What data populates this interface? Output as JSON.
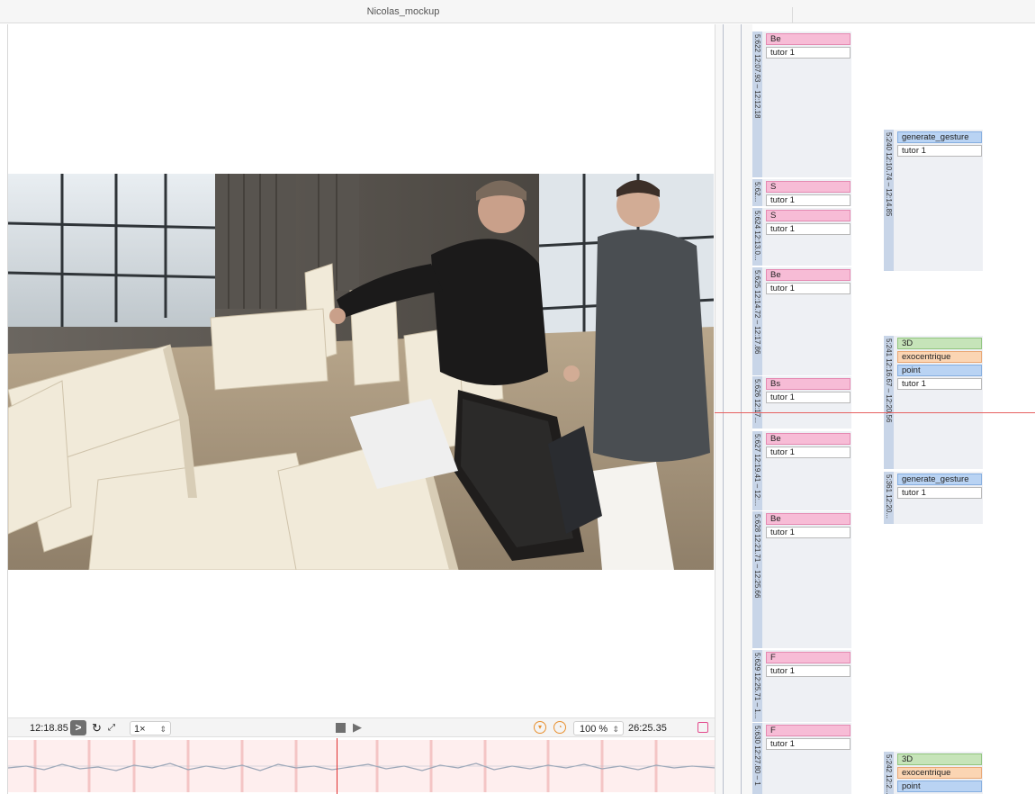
{
  "window": {
    "title": "Nicolas_mockup"
  },
  "player": {
    "current_time": "12:18.85",
    "rate": "1×",
    "zoom": "100 %",
    "duration": "26:25.35",
    "icons": [
      "next-icon",
      "loop-icon",
      "fullscreen-icon",
      "stop-icon",
      "play-icon",
      "marker-icon",
      "clock-icon",
      "sidebar-toggle-icon"
    ]
  },
  "annotations": {
    "col1": [
      {
        "time": "5:622 12:07.93 – 12:12.18",
        "tags": [
          {
            "text": "Be",
            "color": "pink"
          },
          {
            "text": "tutor 1",
            "color": "white"
          }
        ]
      },
      {
        "time": "5:62...",
        "tags": [
          {
            "text": "S",
            "color": "pink"
          },
          {
            "text": "tutor 1",
            "color": "white"
          }
        ]
      },
      {
        "time": "5:624 12:13.0...",
        "tags": [
          {
            "text": "S",
            "color": "pink"
          },
          {
            "text": "tutor 1",
            "color": "white"
          }
        ]
      },
      {
        "time": "5:625 12:14.72 – 12:17.86",
        "tags": [
          {
            "text": "Be",
            "color": "pink"
          },
          {
            "text": "tutor 1",
            "color": "white"
          }
        ]
      },
      {
        "time": "5:626 12:17...",
        "tags": [
          {
            "text": "Bs",
            "color": "pink"
          },
          {
            "text": "tutor 1",
            "color": "white"
          }
        ]
      },
      {
        "time": "5:627 12:19.41 – 12:...",
        "tags": [
          {
            "text": "Be",
            "color": "pink"
          },
          {
            "text": "tutor 1",
            "color": "white"
          }
        ]
      },
      {
        "time": "5:628 12:21.71 – 12:25.66",
        "tags": [
          {
            "text": "Be",
            "color": "pink"
          },
          {
            "text": "tutor 1",
            "color": "white"
          }
        ]
      },
      {
        "time": "5:629 12:25.71 – 1...",
        "tags": [
          {
            "text": "F",
            "color": "pink"
          },
          {
            "text": "tutor 1",
            "color": "white"
          }
        ]
      },
      {
        "time": "5:630 12:27.80 – 1",
        "tags": [
          {
            "text": "F",
            "color": "pink"
          },
          {
            "text": "tutor 1",
            "color": "white"
          }
        ]
      }
    ],
    "col2": [
      {
        "time": "5:240 12:10.74 – 12:14.85",
        "tags": [
          {
            "text": "generate_gesture",
            "color": "blue"
          },
          {
            "text": "tutor 1",
            "color": "white"
          }
        ]
      },
      {
        "time": "5:241 12:16.67 – 12:20.56",
        "tags": [
          {
            "text": "3D",
            "color": "green"
          },
          {
            "text": "exocentrique",
            "color": "peach"
          },
          {
            "text": "point",
            "color": "blue"
          },
          {
            "text": "tutor 1",
            "color": "white"
          }
        ]
      },
      {
        "time": "5:361 12:20...",
        "tags": [
          {
            "text": "generate_gesture",
            "color": "blue"
          },
          {
            "text": "tutor 1",
            "color": "white"
          }
        ]
      },
      {
        "time": "5:242 12:2...",
        "tags": [
          {
            "text": "3D",
            "color": "green"
          },
          {
            "text": "exocentrique",
            "color": "peach"
          },
          {
            "text": "point",
            "color": "blue"
          }
        ]
      }
    ]
  }
}
